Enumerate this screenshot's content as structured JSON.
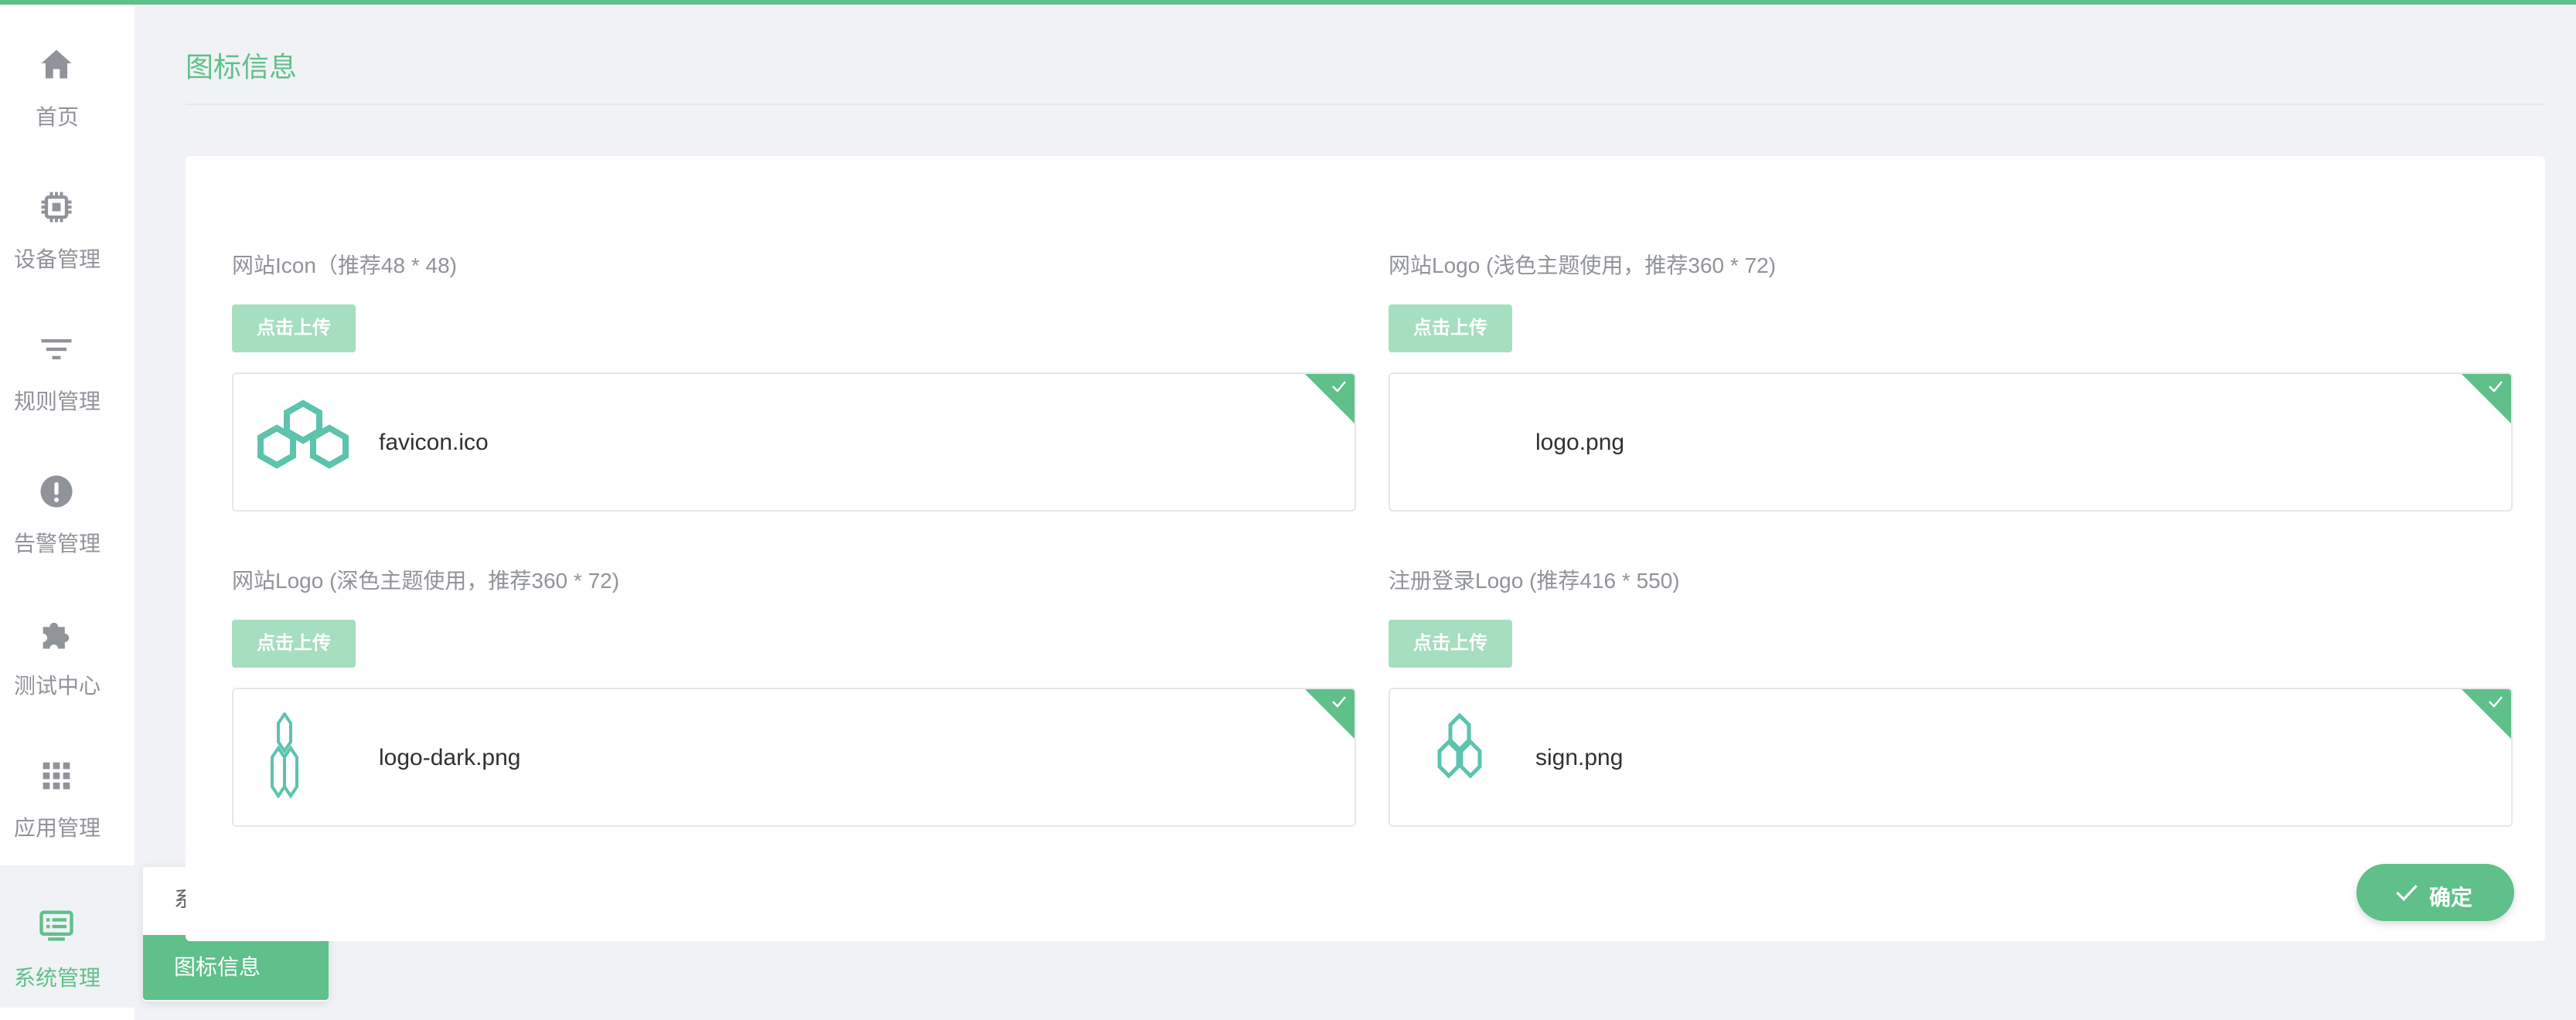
{
  "sidebar": {
    "items": [
      {
        "label": "首页",
        "icon": "home-icon"
      },
      {
        "label": "设备管理",
        "icon": "chip-icon"
      },
      {
        "label": "规则管理",
        "icon": "filter-icon"
      },
      {
        "label": "告警管理",
        "icon": "alert-icon"
      },
      {
        "label": "测试中心",
        "icon": "puzzle-icon"
      },
      {
        "label": "应用管理",
        "icon": "grid-icon"
      },
      {
        "label": "系统管理",
        "icon": "monitor-icon",
        "active": true
      }
    ]
  },
  "submenu": {
    "items": [
      {
        "label": "系统信息"
      },
      {
        "label": "图标信息",
        "active": true
      }
    ]
  },
  "page": {
    "title": "图标信息"
  },
  "uploads": [
    {
      "label": "网站Icon（推荐48 * 48)",
      "button": "点击上传",
      "file": "favicon.ico"
    },
    {
      "label": "网站Logo (浅色主题使用，推荐360 * 72)",
      "button": "点击上传",
      "file": "logo.png"
    },
    {
      "label": "网站Logo (深色主题使用，推荐360 * 72)",
      "button": "点击上传",
      "file": "logo-dark.png"
    },
    {
      "label": "注册登录Logo (推荐416 * 550)",
      "button": "点击上传",
      "file": "sign.png"
    }
  ],
  "confirm_label": "确定",
  "colors": {
    "accent": "#5fc08a",
    "accent_light": "#a6dec0",
    "logo_teal": "#5cc3ad"
  }
}
